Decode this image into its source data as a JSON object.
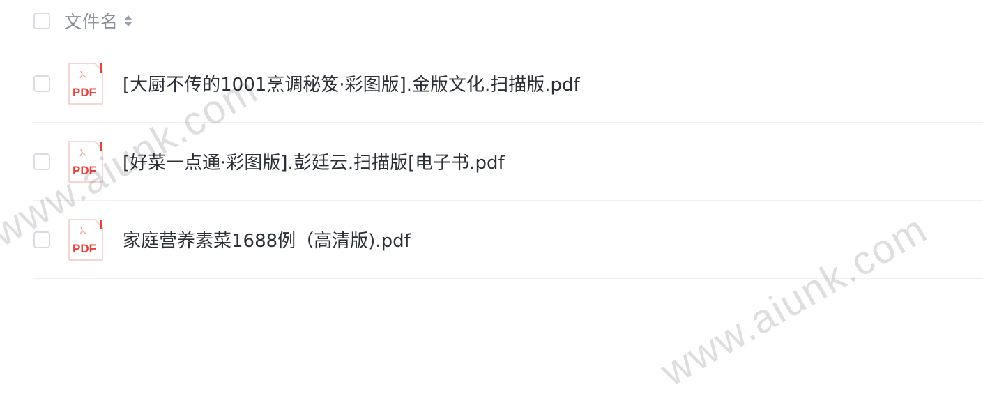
{
  "header": {
    "column_label": "文件名",
    "sort_icon": "sort-icon"
  },
  "files": [
    {
      "name": "[大厨不传的1001烹调秘笈·彩图版].金版文化.扫描版.pdf",
      "icon_label": "PDF",
      "icon": "pdf-file-icon"
    },
    {
      "name": "[好菜一点通·彩图版].彭廷云.扫描版[电子书.pdf",
      "icon_label": "PDF",
      "icon": "pdf-file-icon"
    },
    {
      "name": "家庭营养素菜1688例（高清版).pdf",
      "icon_label": "PDF",
      "icon": "pdf-file-icon"
    }
  ],
  "watermark": "www.aiunk.com",
  "colors": {
    "pdf_red": "#e8403a",
    "text": "#2b2f36",
    "muted": "#8a8f98",
    "border": "#d9dce1"
  }
}
